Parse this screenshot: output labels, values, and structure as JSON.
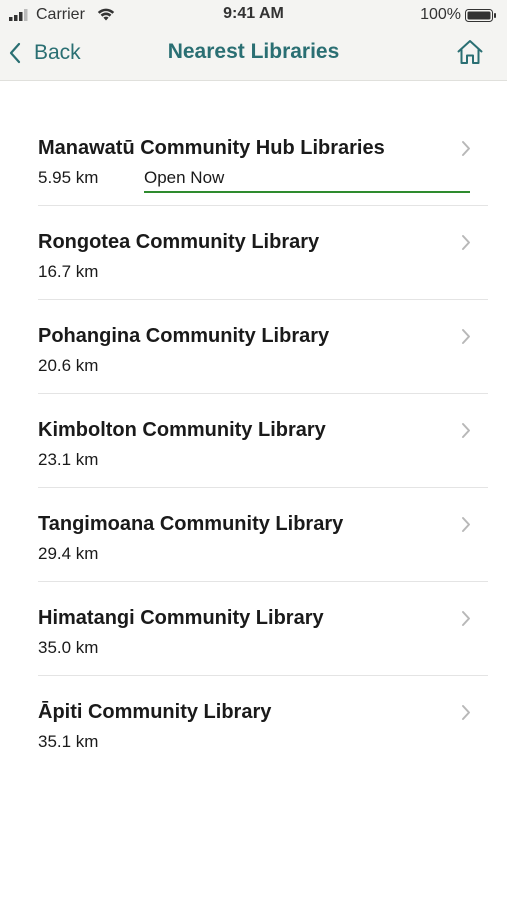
{
  "status_bar": {
    "carrier": "Carrier",
    "time": "9:41 AM",
    "battery": "100%"
  },
  "nav": {
    "back_label": "Back",
    "title": "Nearest Libraries"
  },
  "libraries": [
    {
      "name": "Manawatū Community Hub Libraries",
      "distance": "5.95 km",
      "status": "Open Now"
    },
    {
      "name": "Rongotea Community Library",
      "distance": "16.7 km"
    },
    {
      "name": "Pohangina Community Library",
      "distance": "20.6 km"
    },
    {
      "name": "Kimbolton Community Library",
      "distance": "23.1 km"
    },
    {
      "name": "Tangimoana Community Library",
      "distance": "29.4 km"
    },
    {
      "name": "Himatangi Community Library",
      "distance": "35.0 km"
    },
    {
      "name": "Āpiti Community Library",
      "distance": "35.1 km"
    }
  ],
  "colors": {
    "accent": "#2a6f73",
    "open_indicator": "#2e8b2e",
    "nav_background": "#f4f4f2"
  },
  "icons": {
    "back": "chevron-left-icon",
    "home": "home-icon",
    "row_disclosure": "chevron-right-icon"
  }
}
